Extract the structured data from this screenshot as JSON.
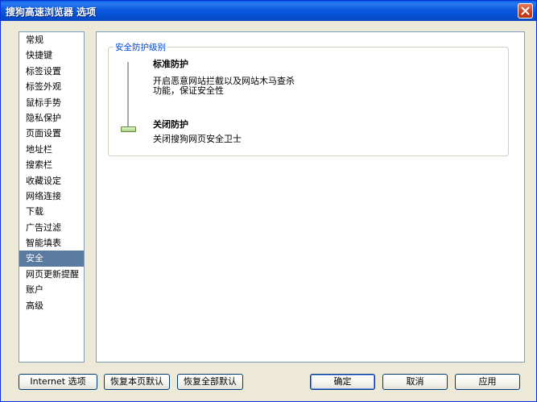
{
  "window": {
    "title": "搜狗高速浏览器 选项"
  },
  "sidebar": {
    "items": [
      {
        "label": "常规"
      },
      {
        "label": "快捷键"
      },
      {
        "label": "标签设置"
      },
      {
        "label": "标签外观"
      },
      {
        "label": "鼠标手势"
      },
      {
        "label": "隐私保护"
      },
      {
        "label": "页面设置"
      },
      {
        "label": "地址栏"
      },
      {
        "label": "搜索栏"
      },
      {
        "label": "收藏设定"
      },
      {
        "label": "网络连接"
      },
      {
        "label": "下载"
      },
      {
        "label": "广告过滤"
      },
      {
        "label": "智能填表"
      },
      {
        "label": "安全"
      },
      {
        "label": "网页更新提醒"
      },
      {
        "label": "账户"
      },
      {
        "label": "高级"
      }
    ],
    "selected": "安全"
  },
  "security": {
    "group_label": "安全防护级别",
    "slider_level": 0,
    "levels": [
      {
        "title": "标准防护",
        "desc_line1": "开启恶意网站拦截以及网站木马查杀",
        "desc_line2": "功能，保证安全性"
      },
      {
        "title": "关闭防护",
        "desc_line1": "关闭搜狗网页安全卫士"
      }
    ]
  },
  "buttons": {
    "internet_options": "Internet 选项",
    "restore_page": "恢复本页默认",
    "restore_all": "恢复全部默认",
    "ok": "确定",
    "cancel": "取消",
    "apply": "应用"
  },
  "colors": {
    "title_bar": "#0a5fdf",
    "selected_item": "#5a7aa0",
    "group_label": "#0046d5"
  }
}
